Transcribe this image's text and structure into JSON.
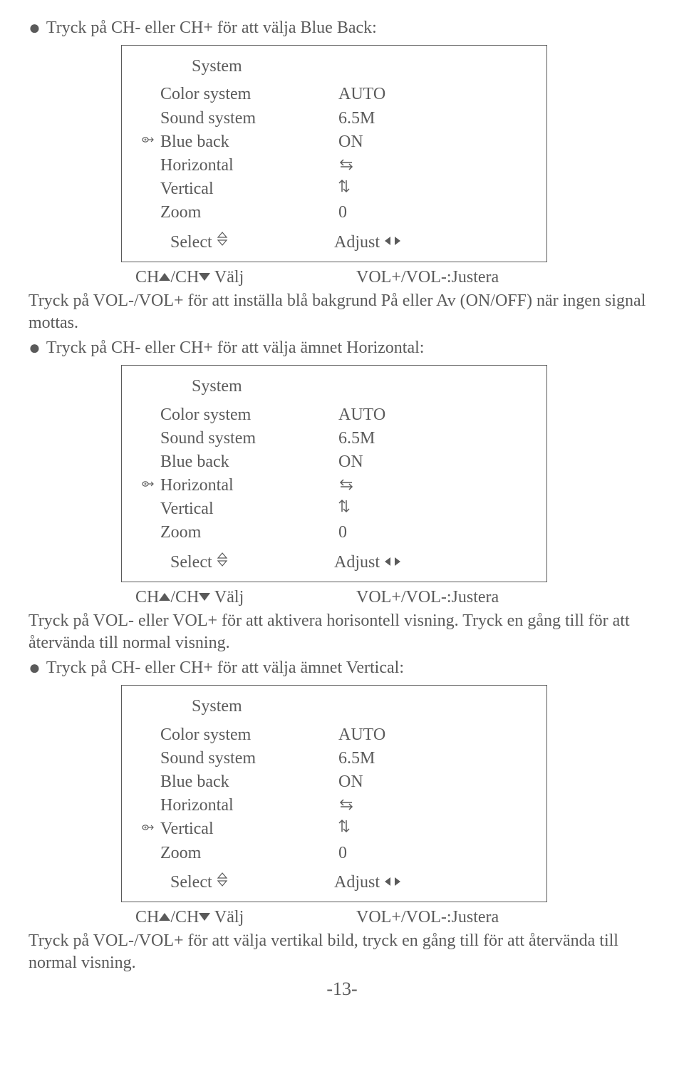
{
  "section1": {
    "instruction": "Tryck på CH- eller CH+ för att välja Blue Back:",
    "menu": {
      "title": "System",
      "items": [
        {
          "label": "Color system",
          "value": "AUTO",
          "selected": false
        },
        {
          "label": "Sound system",
          "value": "6.5M",
          "selected": false
        },
        {
          "label": "Blue back",
          "value": "ON",
          "selected": true
        },
        {
          "label": "Horizontal",
          "value": "hswap",
          "selected": false
        },
        {
          "label": "Vertical",
          "value": "vswap",
          "selected": false
        },
        {
          "label": "Zoom",
          "value": "0",
          "selected": false
        }
      ],
      "select_label": "Select",
      "adjust_label": "Adjust"
    },
    "nav_left": "/CH",
    "nav_left_tail": " Välj",
    "nav_right": "VOL+/VOL-:Justera",
    "body": "Tryck på VOL-/VOL+ för att inställa blå bakgrund På eller Av (ON/OFF) när ingen signal mottas."
  },
  "section2": {
    "instruction": "Tryck på CH- eller CH+ för att välja ämnet Horizontal:",
    "menu": {
      "title": "System",
      "items": [
        {
          "label": "Color system",
          "value": "AUTO",
          "selected": false
        },
        {
          "label": "Sound system",
          "value": "6.5M",
          "selected": false
        },
        {
          "label": "Blue back",
          "value": "ON",
          "selected": false
        },
        {
          "label": "Horizontal",
          "value": "hswap",
          "selected": true
        },
        {
          "label": "Vertical",
          "value": "vswap",
          "selected": false
        },
        {
          "label": "Zoom",
          "value": "0",
          "selected": false
        }
      ],
      "select_label": "Select",
      "adjust_label": "Adjust"
    },
    "nav_left_tail": " Välj",
    "nav_right": "VOL+/VOL-:Justera",
    "body": "Tryck på VOL- eller VOL+ för att aktivera horisontell visning. Tryck en gång till för att återvända till normal visning."
  },
  "section3": {
    "instruction": "Tryck på CH- eller CH+ för att välja ämnet Vertical:",
    "menu": {
      "title": "System",
      "items": [
        {
          "label": "Color system",
          "value": "AUTO",
          "selected": false
        },
        {
          "label": "Sound system",
          "value": "6.5M",
          "selected": false
        },
        {
          "label": "Blue back",
          "value": "ON",
          "selected": false
        },
        {
          "label": "Horizontal",
          "value": "hswap",
          "selected": false
        },
        {
          "label": "Vertical",
          "value": "vswap",
          "selected": true
        },
        {
          "label": "Zoom",
          "value": "0",
          "selected": false
        }
      ],
      "select_label": "Select",
      "adjust_label": "Adjust"
    },
    "nav_left_tail": " Välj",
    "nav_right": "VOL+/VOL-:Justera",
    "body": "Tryck på VOL-/VOL+ för att välja vertikal bild, tryck en gång till för att återvända till normal visning."
  },
  "page_number": "-13-",
  "ch_prefix": "CH"
}
